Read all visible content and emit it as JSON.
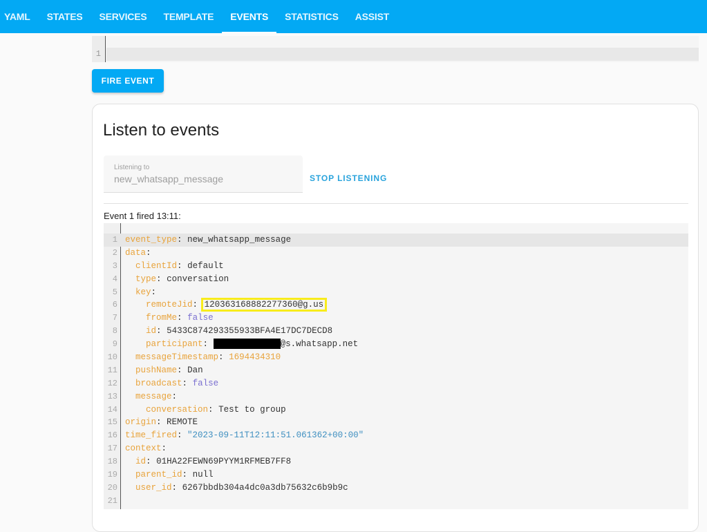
{
  "tabs": [
    {
      "label": "YAML",
      "active": false
    },
    {
      "label": "STATES",
      "active": false
    },
    {
      "label": "SERVICES",
      "active": false
    },
    {
      "label": "TEMPLATE",
      "active": false
    },
    {
      "label": "EVENTS",
      "active": true
    },
    {
      "label": "STATISTICS",
      "active": false
    },
    {
      "label": "ASSIST",
      "active": false
    }
  ],
  "fire_editor": {
    "line_number": "1"
  },
  "fire_button": "FIRE EVENT",
  "listen": {
    "title": "Listen to events",
    "field_label": "Listening to",
    "field_value": "new_whatsapp_message",
    "stop_button": "STOP LISTENING",
    "event_header": "Event 1 fired 13:11:"
  },
  "event_yaml": {
    "lines": [
      {
        "n": "1",
        "indent": "",
        "key": "event_type",
        "value": "new_whatsapp_message",
        "type": "plain"
      },
      {
        "n": "2",
        "indent": "",
        "key": "data",
        "value": "",
        "type": "plain"
      },
      {
        "n": "3",
        "indent": "  ",
        "key": "clientId",
        "value": "default",
        "type": "plain"
      },
      {
        "n": "4",
        "indent": "  ",
        "key": "type",
        "value": "conversation",
        "type": "plain"
      },
      {
        "n": "5",
        "indent": "  ",
        "key": "key",
        "value": "",
        "type": "plain"
      },
      {
        "n": "6",
        "indent": "    ",
        "key": "remoteJid",
        "value": "120363168882277360@g.us",
        "type": "highlight"
      },
      {
        "n": "7",
        "indent": "    ",
        "key": "fromMe",
        "value": "false",
        "type": "bool"
      },
      {
        "n": "8",
        "indent": "    ",
        "key": "id",
        "value": "5433C874293355933BFA4E17DC7DECD8",
        "type": "plain"
      },
      {
        "n": "9",
        "indent": "    ",
        "key": "participant",
        "value": "@s.whatsapp.net",
        "type": "redacted"
      },
      {
        "n": "10",
        "indent": "  ",
        "key": "messageTimestamp",
        "value": "1694434310",
        "type": "number"
      },
      {
        "n": "11",
        "indent": "  ",
        "key": "pushName",
        "value": "Dan",
        "type": "plain"
      },
      {
        "n": "12",
        "indent": "  ",
        "key": "broadcast",
        "value": "false",
        "type": "bool"
      },
      {
        "n": "13",
        "indent": "  ",
        "key": "message",
        "value": "",
        "type": "plain"
      },
      {
        "n": "14",
        "indent": "    ",
        "key": "conversation",
        "value": "Test to group",
        "type": "plain"
      },
      {
        "n": "15",
        "indent": "",
        "key": "origin",
        "value": "REMOTE",
        "type": "plain"
      },
      {
        "n": "16",
        "indent": "",
        "key": "time_fired",
        "value": "\"2023-09-11T12:11:51.061362+00:00\"",
        "type": "string"
      },
      {
        "n": "17",
        "indent": "",
        "key": "context",
        "value": "",
        "type": "plain"
      },
      {
        "n": "18",
        "indent": "  ",
        "key": "id",
        "value": "01HA22FEWN69PYYM1RFMEB7FF8",
        "type": "plain"
      },
      {
        "n": "19",
        "indent": "  ",
        "key": "parent_id",
        "value": "null",
        "type": "plain"
      },
      {
        "n": "20",
        "indent": "  ",
        "key": "user_id",
        "value": "6267bbdb304a4dc0a3db75632c6b9b9c",
        "type": "plain"
      },
      {
        "n": "21",
        "indent": "",
        "key": "",
        "value": "",
        "type": "empty"
      }
    ]
  },
  "colors": {
    "header": "#03a9f4",
    "yaml_key": "#e8a33b",
    "yaml_bool": "#7a6fd0",
    "yaml_string": "#3f8fc0",
    "highlight_box": "#f8ec1c"
  }
}
